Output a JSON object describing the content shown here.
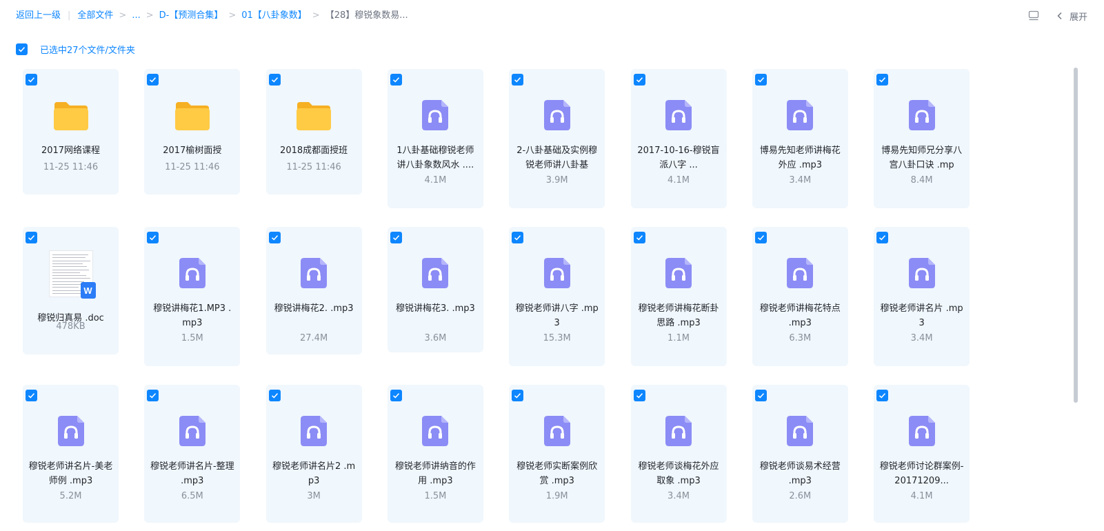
{
  "breadcrumb": {
    "back_label": "返回上一级",
    "root_label": "全部文件",
    "ellipsis": "...",
    "items": [
      "D-【预测合集】",
      "01【八卦象数】"
    ],
    "current": "【28】穆锐象数易..."
  },
  "toolbar": {
    "expand_label": "展开"
  },
  "selection": {
    "label": "已选中27个文件/文件夹",
    "checked": true
  },
  "colors": {
    "accent": "#0d86ff",
    "folder": "#ffcb45",
    "audio": "#8b8cf5",
    "card_bg": "#f0f7fd"
  },
  "files": [
    {
      "type": "folder",
      "name": "2017网络课程",
      "meta": "11-25 11:46",
      "icon": "folder-icon"
    },
    {
      "type": "folder",
      "name": "2017榆树面授",
      "meta": "11-25 11:46",
      "icon": "folder-icon"
    },
    {
      "type": "folder",
      "name": "2018成都面授班",
      "meta": "11-25 11:46",
      "icon": "folder-icon"
    },
    {
      "type": "audio",
      "name": "1八卦基础穆锐老师讲八卦象数风水 ....",
      "meta": "4.1M",
      "icon": "audio-file-icon"
    },
    {
      "type": "audio",
      "name": "2-八卦基础及实例穆锐老师讲八卦基",
      "meta": "3.9M",
      "icon": "audio-file-icon"
    },
    {
      "type": "audio",
      "name": "2017-10-16-穆锐盲派八字 ...",
      "meta": "4.1M",
      "icon": "audio-file-icon"
    },
    {
      "type": "audio",
      "name": "博易先知老师讲梅花外应 .mp3",
      "meta": "3.4M",
      "icon": "audio-file-icon"
    },
    {
      "type": "audio",
      "name": "博易先知师兄分享八宫八卦口诀 .mp",
      "meta": "8.4M",
      "icon": "audio-file-icon"
    },
    {
      "type": "doc",
      "name": "穆锐归真易 .doc",
      "meta": "478KB",
      "icon": "word-doc-icon"
    },
    {
      "type": "audio",
      "name": "穆锐讲梅花1.MP3 .mp3",
      "meta": "1.5M",
      "icon": "audio-file-icon"
    },
    {
      "type": "audio",
      "name": "穆锐讲梅花2. .mp3",
      "meta": "27.4M",
      "icon": "audio-file-icon"
    },
    {
      "type": "audio",
      "name": "穆锐讲梅花3. .mp3",
      "meta": "3.6M",
      "icon": "audio-file-icon"
    },
    {
      "type": "audio",
      "name": "穆锐老师讲八字 .mp3",
      "meta": "15.3M",
      "icon": "audio-file-icon"
    },
    {
      "type": "audio",
      "name": "穆锐老师讲梅花断卦思路 .mp3",
      "meta": "1.1M",
      "icon": "audio-file-icon"
    },
    {
      "type": "audio",
      "name": "穆锐老师讲梅花特点 .mp3",
      "meta": "6.3M",
      "icon": "audio-file-icon"
    },
    {
      "type": "audio",
      "name": "穆锐老师讲名片 .mp3",
      "meta": "3.4M",
      "icon": "audio-file-icon"
    },
    {
      "type": "audio",
      "name": "穆锐老师讲名片-美老师例 .mp3",
      "meta": "5.2M",
      "icon": "audio-file-icon"
    },
    {
      "type": "audio",
      "name": "穆锐老师讲名片-整理 .mp3",
      "meta": "6.5M",
      "icon": "audio-file-icon"
    },
    {
      "type": "audio",
      "name": "穆锐老师讲名片2 .mp3",
      "meta": "3M",
      "icon": "audio-file-icon"
    },
    {
      "type": "audio",
      "name": "穆锐老师讲纳音的作用 .mp3",
      "meta": "1.5M",
      "icon": "audio-file-icon"
    },
    {
      "type": "audio",
      "name": "穆锐老师实断案例欣赏 .mp3",
      "meta": "1.9M",
      "icon": "audio-file-icon"
    },
    {
      "type": "audio",
      "name": "穆锐老师谈梅花外应取象 .mp3",
      "meta": "3.4M",
      "icon": "audio-file-icon"
    },
    {
      "type": "audio",
      "name": "穆锐老师谈易术经营 .mp3",
      "meta": "2.6M",
      "icon": "audio-file-icon"
    },
    {
      "type": "audio",
      "name": "穆锐老师讨论群案例-20171209...",
      "meta": "4.1M",
      "icon": "audio-file-icon"
    }
  ]
}
